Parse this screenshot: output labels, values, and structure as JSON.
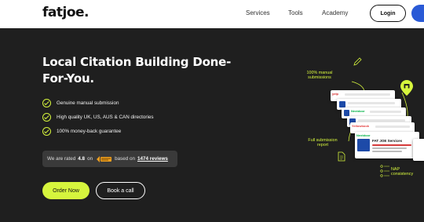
{
  "header": {
    "logo": "fatjoe.",
    "nav": [
      "Services",
      "Tools",
      "Academy"
    ],
    "login_label": "Login"
  },
  "hero": {
    "title": "Local Citation Building Done-For-You.",
    "features": [
      "Genuine manual submission",
      "High quality UK, US, AUS & CAN directories",
      "100% money-back guarantee"
    ],
    "rating": {
      "prefix": "We are rated",
      "score": "4.8",
      "on": "on",
      "middle": "based on",
      "reviews": "1474 reviews"
    },
    "order_label": "Order Now",
    "call_label": "Book a call"
  },
  "illustration": {
    "manual_label": "100% manual submissions",
    "report_label": "Full submission report",
    "nap_label": "NAP consistency",
    "cards": [
      "yelp",
      "Nextdoor",
      "Yellowbook",
      "Nextdoor"
    ],
    "listing_title": "FAT JOE Services",
    "icons": [
      "pencil-icon",
      "location-pin-icon",
      "document-icon",
      "shop-icon"
    ]
  },
  "colors": {
    "accent": "#d6f53d",
    "background": "#1f1f1f",
    "header_bg": "#ffffff",
    "signup": "#2a5ad6"
  }
}
